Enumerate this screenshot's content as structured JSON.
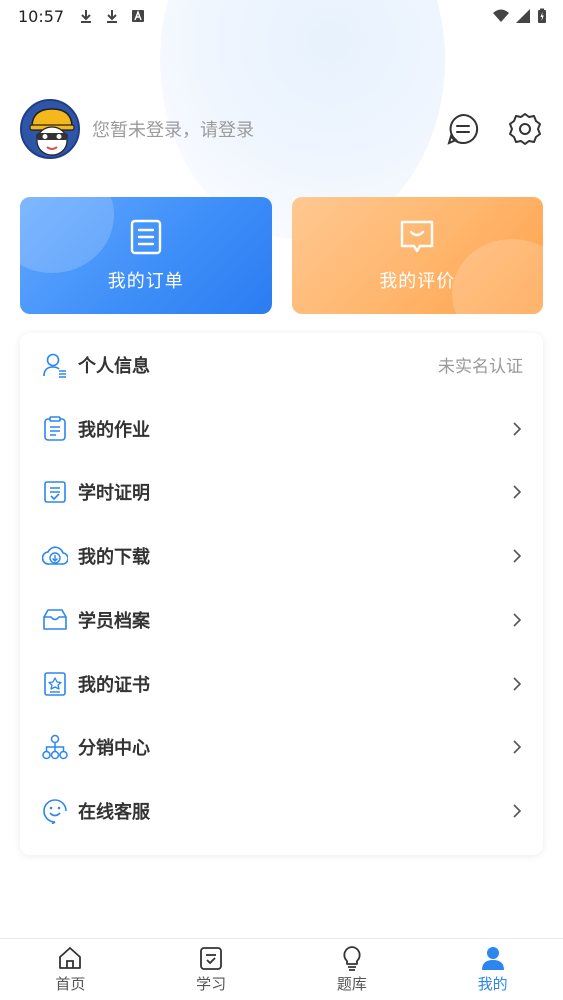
{
  "status_bar": {
    "time": "10:57"
  },
  "profile": {
    "login_prompt": "您暂未登录，请登录"
  },
  "cards": [
    {
      "label": "我的订单",
      "icon": "order-icon"
    },
    {
      "label": "我的评价",
      "icon": "review-icon"
    }
  ],
  "menu": {
    "items": [
      {
        "label": "个人信息",
        "icon": "user-info-icon",
        "value": "未实名认证"
      },
      {
        "label": "我的作业",
        "icon": "homework-icon"
      },
      {
        "label": "学时证明",
        "icon": "study-hours-icon"
      },
      {
        "label": "我的下载",
        "icon": "download-icon"
      },
      {
        "label": "学员档案",
        "icon": "archive-icon"
      },
      {
        "label": "我的证书",
        "icon": "certificate-icon"
      },
      {
        "label": "分销中心",
        "icon": "distribution-icon"
      },
      {
        "label": "在线客服",
        "icon": "customer-service-icon"
      }
    ]
  },
  "tabbar": {
    "tabs": [
      {
        "label": "首页",
        "icon": "home-icon"
      },
      {
        "label": "学习",
        "icon": "study-icon"
      },
      {
        "label": "题库",
        "icon": "question-bank-icon"
      },
      {
        "label": "我的",
        "icon": "me-icon",
        "active": true
      }
    ]
  },
  "colors": {
    "primary": "#2b86ee",
    "card_blue": "#3f8ff9",
    "card_orange": "#ffb56c"
  }
}
